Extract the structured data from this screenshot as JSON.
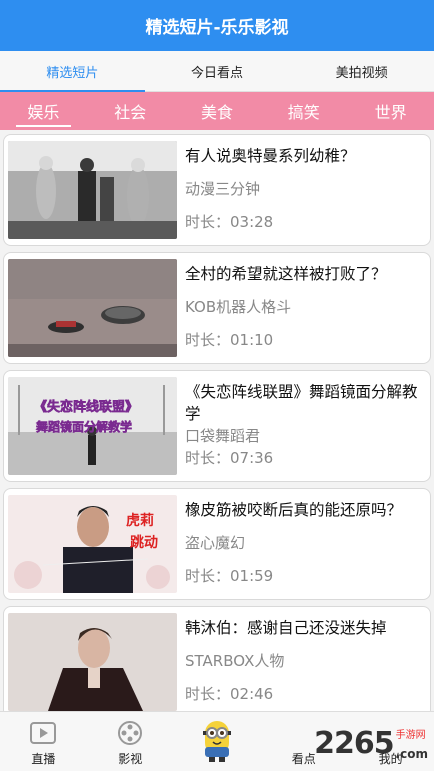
{
  "app": {
    "title": "精选短片-乐乐影视"
  },
  "top_tabs": [
    {
      "label": "精选短片"
    },
    {
      "label": "今日看点"
    },
    {
      "label": "美拍视频"
    }
  ],
  "categories": [
    {
      "label": "娱乐"
    },
    {
      "label": "社会"
    },
    {
      "label": "美食"
    },
    {
      "label": "搞笑"
    },
    {
      "label": "世界"
    }
  ],
  "videos": [
    {
      "title": "有人说奥特曼系列幼稚？",
      "source": "动漫三分钟",
      "duration": "时长：03:28"
    },
    {
      "title": "全村的希望就这样被打败了？",
      "source": "KOB机器人格斗",
      "duration": "时长：01:10"
    },
    {
      "title": "《失恋阵线联盟》舞蹈镜面分解教学",
      "source": "口袋舞蹈君",
      "duration": "时长：07:36",
      "thumb_text_1": "《失恋阵线联盟》",
      "thumb_text_2": "舞蹈镜面分解教学"
    },
    {
      "title": "橡皮筋被咬断后真的能还原吗？",
      "source": "盗心魔幻",
      "duration": "时长：01:59",
      "thumb_text_1": "虎莉",
      "thumb_text_2": "跳动"
    },
    {
      "title": "韩沐伯：感谢自己还没迷失掉",
      "source": "STARBOX人物",
      "duration": "时长：02:46"
    }
  ],
  "bottom_nav": [
    {
      "label": "直播",
      "icon": "play-icon"
    },
    {
      "label": "影视",
      "icon": "film-reel-icon"
    },
    {
      "label": "",
      "icon": "minion-mascot-icon"
    },
    {
      "label": "看点",
      "icon": "eye-icon"
    },
    {
      "label": "我的",
      "icon": "user-icon"
    }
  ],
  "watermark": {
    "number": "2265",
    "suffix": "手游网",
    "domain": ".com"
  },
  "colors": {
    "title_bar": "#2e8ef0",
    "category_bar": "#f28ba6",
    "active_tab": "#2e8ef0"
  }
}
